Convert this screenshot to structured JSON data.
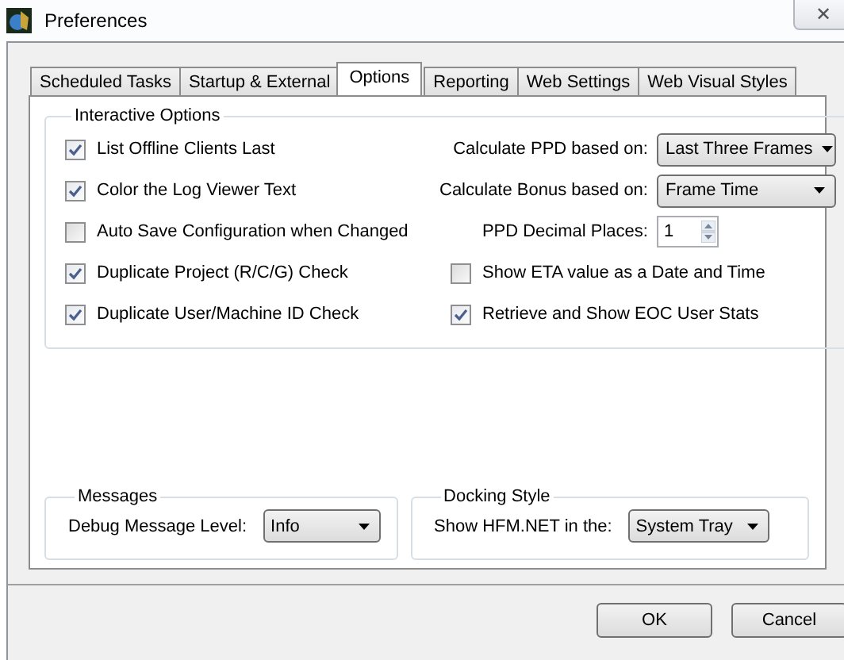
{
  "window": {
    "title": "Preferences",
    "close_glyph": "✕"
  },
  "tabs": [
    {
      "label": "Scheduled Tasks",
      "selected": false
    },
    {
      "label": "Startup & External",
      "selected": false
    },
    {
      "label": "Options",
      "selected": true
    },
    {
      "label": "Reporting",
      "selected": false
    },
    {
      "label": "Web Settings",
      "selected": false
    },
    {
      "label": "Web Visual Styles",
      "selected": false
    }
  ],
  "interactive_options": {
    "title": "Interactive Options",
    "left": [
      {
        "label": "List Offline Clients Last",
        "checked": true
      },
      {
        "label": "Color the Log Viewer Text",
        "checked": true
      },
      {
        "label": "Auto Save Configuration when Changed",
        "checked": false
      },
      {
        "label": "Duplicate Project (R/C/G) Check",
        "checked": true
      },
      {
        "label": "Duplicate User/Machine ID Check",
        "checked": true
      }
    ],
    "right": [
      {
        "kind": "dropdown",
        "label": "Calculate PPD based on:",
        "value": "Last Three Frames"
      },
      {
        "kind": "dropdown",
        "label": "Calculate Bonus based on:",
        "value": "Frame Time"
      },
      {
        "kind": "spinner",
        "label": "PPD Decimal Places:",
        "value": "1"
      },
      {
        "kind": "checkbox",
        "label": "Show ETA value as a Date and Time",
        "checked": false
      },
      {
        "kind": "checkbox",
        "label": "Retrieve and Show EOC User Stats",
        "checked": true
      }
    ]
  },
  "messages": {
    "title": "Messages",
    "label": "Debug Message Level:",
    "value": "Info"
  },
  "docking_style": {
    "title": "Docking Style",
    "label": "Show HFM.NET in the:",
    "value": "System Tray"
  },
  "buttons": [
    "OK",
    "Cancel"
  ]
}
